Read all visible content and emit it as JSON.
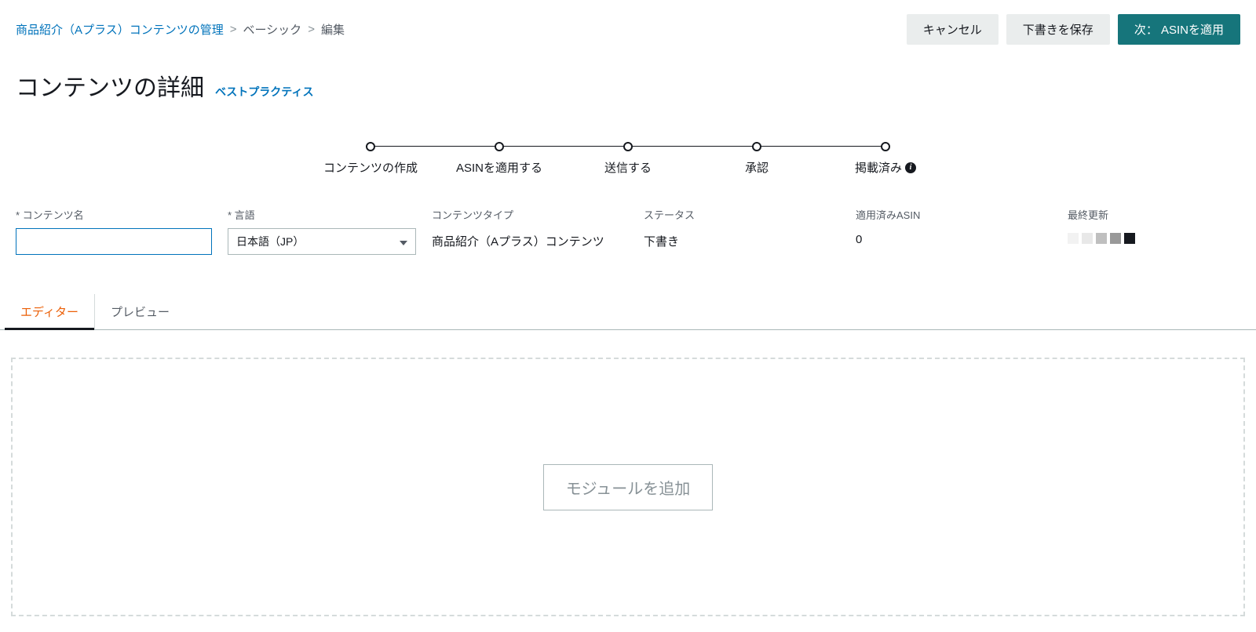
{
  "breadcrumb": {
    "root": "商品紹介（Aプラス）コンテンツの管理",
    "level1": "ベーシック",
    "level2": "編集",
    "sep": ">"
  },
  "actions": {
    "cancel": "キャンセル",
    "save_draft": "下書きを保存",
    "next_apply_asin": "次： ASINを適用"
  },
  "heading": {
    "title": "コンテンツの詳細",
    "best_practices": "ベストプラクティス"
  },
  "stepper": {
    "steps": [
      {
        "label": "コンテンツの作成"
      },
      {
        "label": "ASINを適用する"
      },
      {
        "label": "送信する"
      },
      {
        "label": "承認"
      },
      {
        "label": "掲載済み"
      }
    ]
  },
  "form": {
    "content_name": {
      "label": "* コンテンツ名",
      "value": ""
    },
    "language": {
      "label": "* 言語",
      "value": "日本語（JP）"
    },
    "content_type": {
      "label": "コンテンツタイプ",
      "value": "商品紹介（Aプラス）コンテンツ"
    },
    "status": {
      "label": "ステータス",
      "value": "下書き"
    },
    "applied_asin": {
      "label": "適用済みASIN",
      "value": "0"
    },
    "last_updated": {
      "label": "最終更新"
    }
  },
  "tabs": {
    "editor": "エディター",
    "preview": "プレビュー"
  },
  "editor": {
    "add_module": "モジュールを追加"
  }
}
